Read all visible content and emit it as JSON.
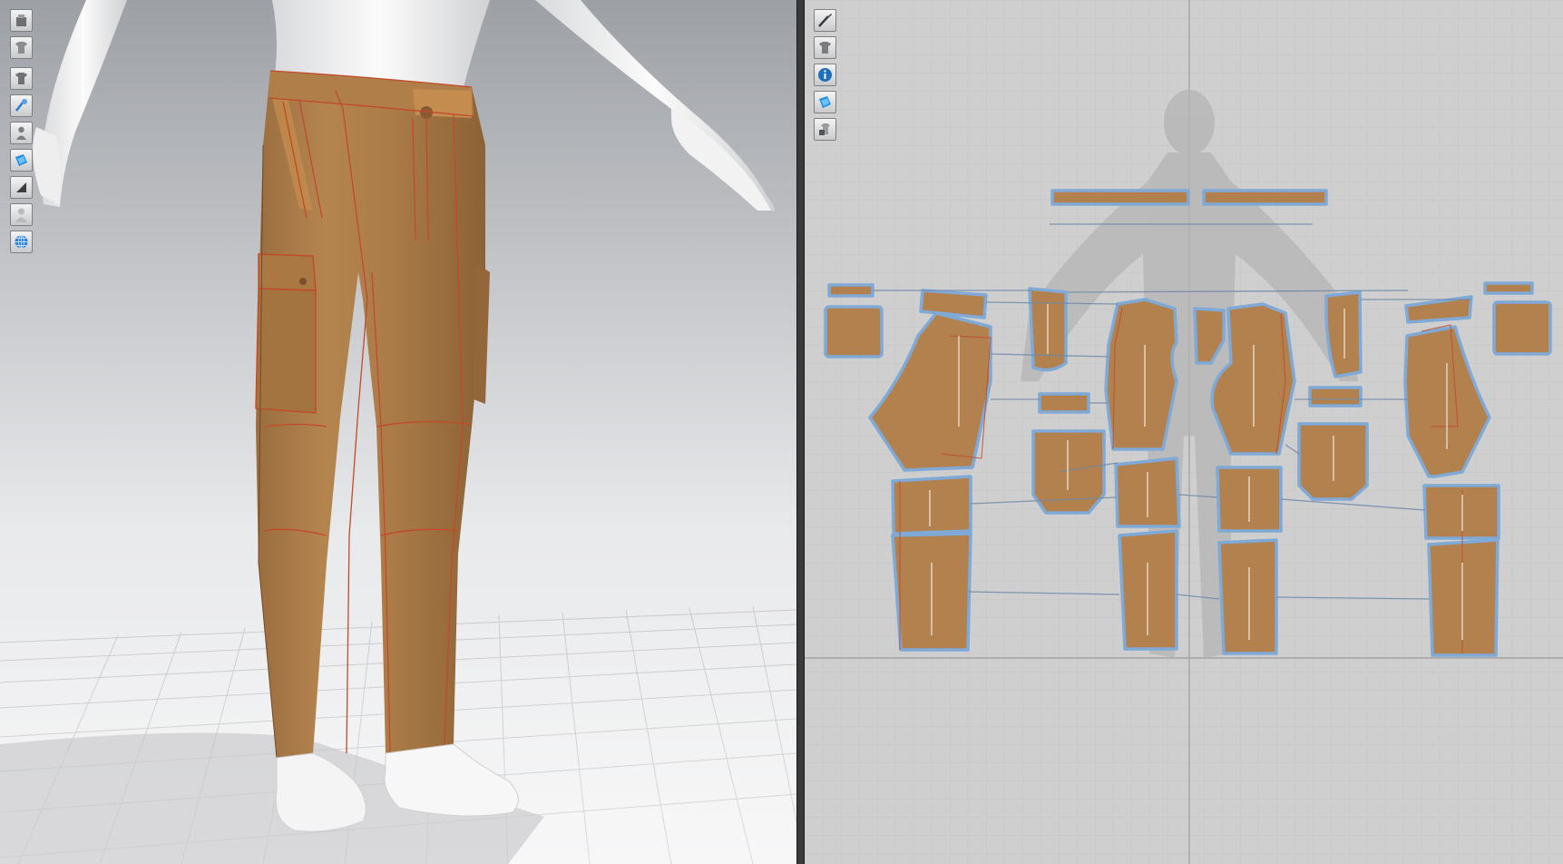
{
  "app": {
    "view_3d": "3d-garment-window",
    "view_2d": "2d-pattern-window"
  },
  "toolbar_3d": {
    "items": [
      {
        "icon": "avatar-display-icon"
      },
      {
        "icon": "garment-display-icon"
      },
      {
        "icon": "show-garment-icon"
      },
      {
        "icon": "show-pins-icon"
      },
      {
        "icon": "show-avatar-icon"
      },
      {
        "icon": "texture-view-icon"
      },
      {
        "icon": "thickness-view-icon"
      },
      {
        "icon": "avatar-silhouette-icon"
      },
      {
        "icon": "grid-globe-icon"
      }
    ]
  },
  "toolbar_2d": {
    "items": [
      {
        "icon": "pattern-edit-icon"
      },
      {
        "icon": "show-garment-2d-icon"
      },
      {
        "icon": "info-icon"
      },
      {
        "icon": "texture-2d-icon"
      },
      {
        "icon": "lock-garment-icon"
      }
    ]
  },
  "colors": {
    "fabric": "#b3814d",
    "fabric_dark": "#8f6236",
    "seam": "#c24a2a",
    "pattern_outline": "#7fa9d6",
    "sewing_line": "#6f8aa6",
    "grid": "#c2c2c2"
  }
}
